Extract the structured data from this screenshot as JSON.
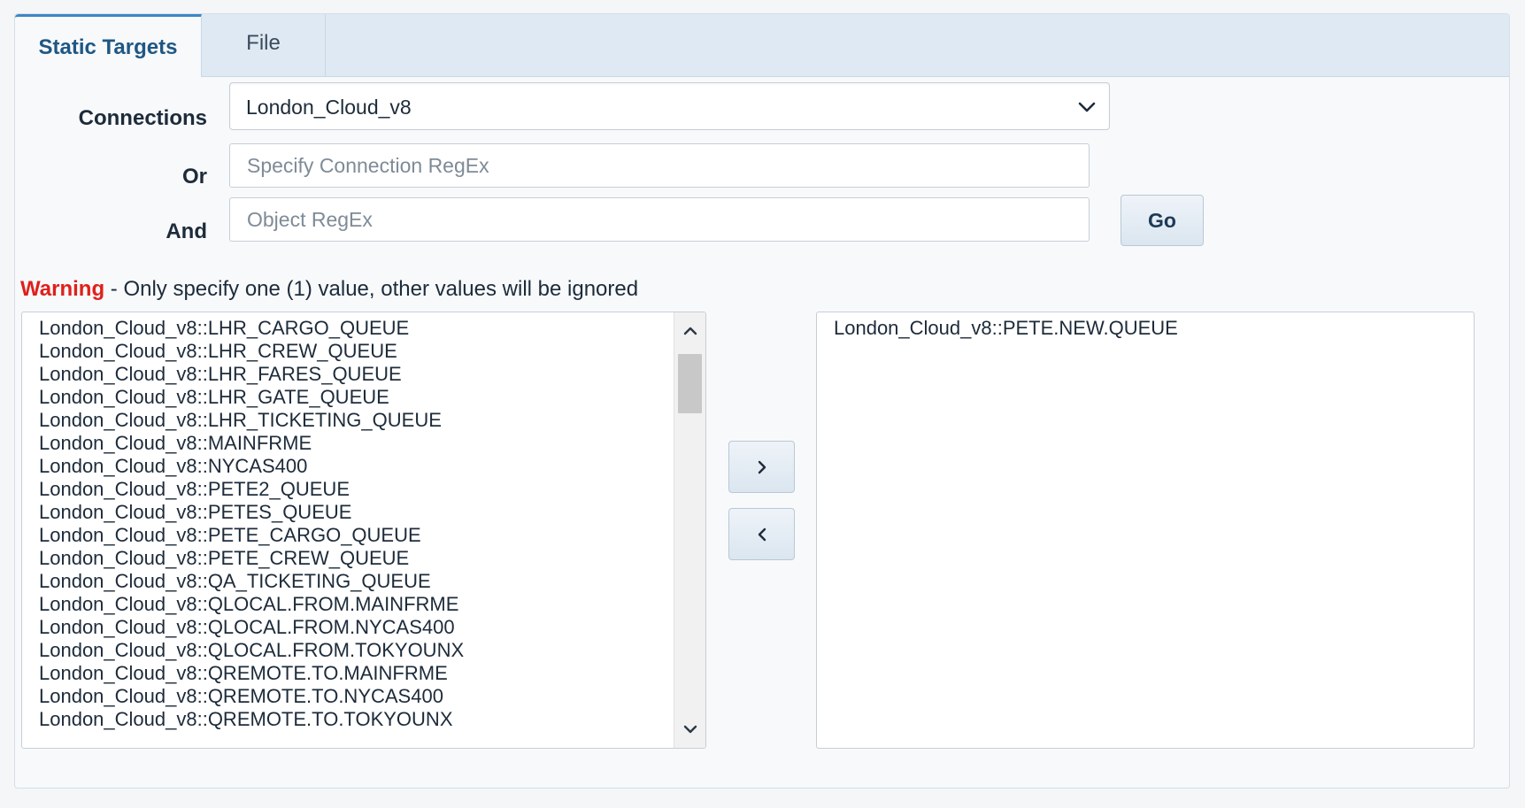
{
  "tabs": [
    {
      "label": "Static Targets",
      "active": true
    },
    {
      "label": "File",
      "active": false
    }
  ],
  "form": {
    "connections_label": "Connections",
    "connections_selected": "London_Cloud_v8",
    "or_label": "Or",
    "connection_regex_placeholder": "Specify Connection RegEx",
    "connection_regex_value": "",
    "and_label": "And",
    "object_regex_placeholder": "Object RegEx",
    "object_regex_value": "",
    "go_label": "Go"
  },
  "warning": {
    "strong": "Warning",
    "text": " - Only specify one (1) value, other values will be ignored"
  },
  "available": {
    "items": [
      "London_Cloud_v8::LHR_CARGO_QUEUE",
      "London_Cloud_v8::LHR_CREW_QUEUE",
      "London_Cloud_v8::LHR_FARES_QUEUE",
      "London_Cloud_v8::LHR_GATE_QUEUE",
      "London_Cloud_v8::LHR_TICKETING_QUEUE",
      "London_Cloud_v8::MAINFRME",
      "London_Cloud_v8::NYCAS400",
      "London_Cloud_v8::PETE2_QUEUE",
      "London_Cloud_v8::PETES_QUEUE",
      "London_Cloud_v8::PETE_CARGO_QUEUE",
      "London_Cloud_v8::PETE_CREW_QUEUE",
      "London_Cloud_v8::QA_TICKETING_QUEUE",
      "London_Cloud_v8::QLOCAL.FROM.MAINFRME",
      "London_Cloud_v8::QLOCAL.FROM.NYCAS400",
      "London_Cloud_v8::QLOCAL.FROM.TOKYOUNX",
      "London_Cloud_v8::QREMOTE.TO.MAINFRME",
      "London_Cloud_v8::QREMOTE.TO.NYCAS400",
      "London_Cloud_v8::QREMOTE.TO.TOKYOUNX"
    ],
    "scroll_fraction": 0.0
  },
  "selected": {
    "items": [
      "London_Cloud_v8::PETE.NEW.QUEUE"
    ]
  },
  "icons": {
    "select_chevron": "chevron-down-icon",
    "move_right": "chevron-right-icon",
    "move_left": "chevron-left-icon",
    "scroll_up": "chevron-up-icon",
    "scroll_down": "chevron-down-icon"
  },
  "colors": {
    "accent": "#3d86c6",
    "warning": "#e0201b",
    "tabbar": "#dfe9f3"
  }
}
